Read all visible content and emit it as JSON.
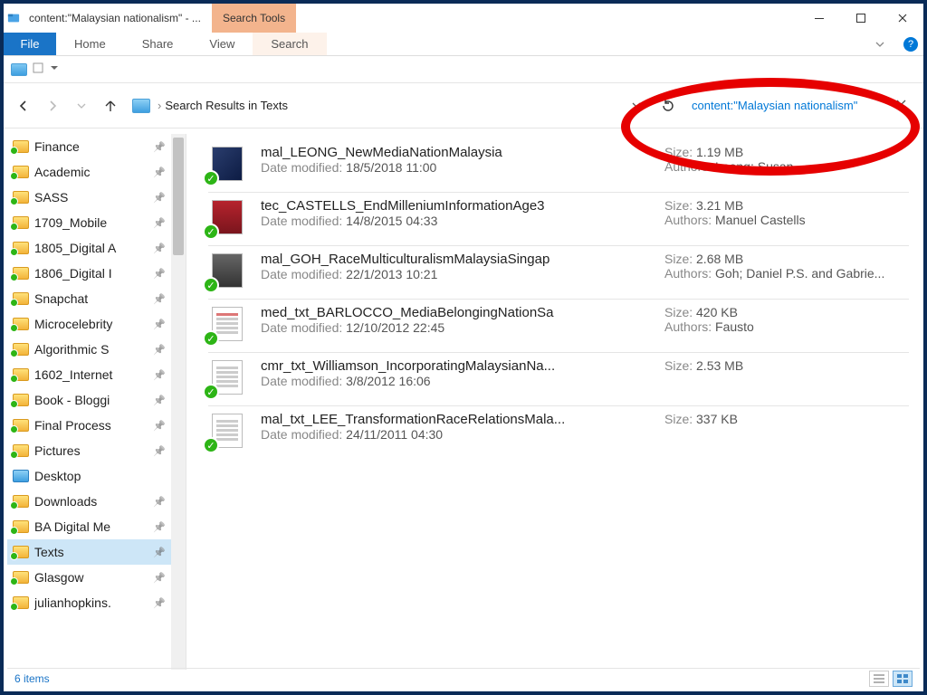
{
  "window": {
    "title": "content:\"Malaysian nationalism\" - ...",
    "search_tools_label": "Search Tools"
  },
  "ribbon": {
    "file": "File",
    "tabs": {
      "home": "Home",
      "share": "Share",
      "view": "View",
      "search": "Search"
    }
  },
  "breadcrumb": {
    "label": "Search Results in Texts"
  },
  "search": {
    "query": "content:\"Malaysian nationalism\""
  },
  "sidebar": {
    "items": [
      {
        "label": "Finance",
        "icon": "folder"
      },
      {
        "label": "Academic",
        "icon": "folder"
      },
      {
        "label": "SASS",
        "icon": "folder"
      },
      {
        "label": "1709_Mobile",
        "icon": "folder"
      },
      {
        "label": "1805_Digital A",
        "icon": "folder"
      },
      {
        "label": "1806_Digital I",
        "icon": "folder"
      },
      {
        "label": "Snapchat",
        "icon": "folder"
      },
      {
        "label": "Microcelebrity",
        "icon": "folder"
      },
      {
        "label": "Algorithmic S",
        "icon": "folder"
      },
      {
        "label": "1602_Internet",
        "icon": "folder"
      },
      {
        "label": "Book - Bloggi",
        "icon": "folder"
      },
      {
        "label": "Final Process",
        "icon": "folder"
      },
      {
        "label": "Pictures",
        "icon": "folder"
      },
      {
        "label": "Desktop",
        "icon": "desktop"
      },
      {
        "label": "Downloads",
        "icon": "folder"
      },
      {
        "label": "BA Digital Me",
        "icon": "folder"
      },
      {
        "label": "Texts",
        "icon": "folder",
        "selected": true
      },
      {
        "label": "Glasgow",
        "icon": "folder"
      },
      {
        "label": "julianhopkins.",
        "icon": "folder"
      }
    ]
  },
  "labels": {
    "date_modified": "Date modified:",
    "size": "Size:",
    "authors": "Authors:"
  },
  "results": [
    {
      "name": "mal_LEONG_NewMediaNationMalaysia",
      "modified": "18/5/2018 11:00",
      "size": "1.19 MB",
      "authors": "Leong; Susan",
      "thumb": "dark"
    },
    {
      "name": "tec_CASTELLS_EndMilleniumInformationAge3",
      "modified": "14/8/2015 04:33",
      "size": "3.21 MB",
      "authors": "Manuel Castells",
      "thumb": "red"
    },
    {
      "name": "mal_GOH_RaceMulticulturalismMalaysiaSingap",
      "modified": "22/1/2013 10:21",
      "size": "2.68 MB",
      "authors": "Goh; Daniel P.S. and Gabrie...",
      "thumb": "grey"
    },
    {
      "name": "med_txt_BARLOCCO_MediaBelongingNationSa",
      "modified": "12/10/2012 22:45",
      "size": "420 KB",
      "authors": "Fausto",
      "thumb": "docred"
    },
    {
      "name": "cmr_txt_Williamson_IncorporatingMalaysianNa...",
      "modified": "3/8/2012 16:06",
      "size": "2.53 MB",
      "authors": "",
      "thumb": "doc"
    },
    {
      "name": "mal_txt_LEE_TransformationRaceRelationsMala...",
      "modified": "24/11/2011 04:30",
      "size": "337 KB",
      "authors": "",
      "thumb": "doc"
    }
  ],
  "status": {
    "count": "6 items"
  }
}
